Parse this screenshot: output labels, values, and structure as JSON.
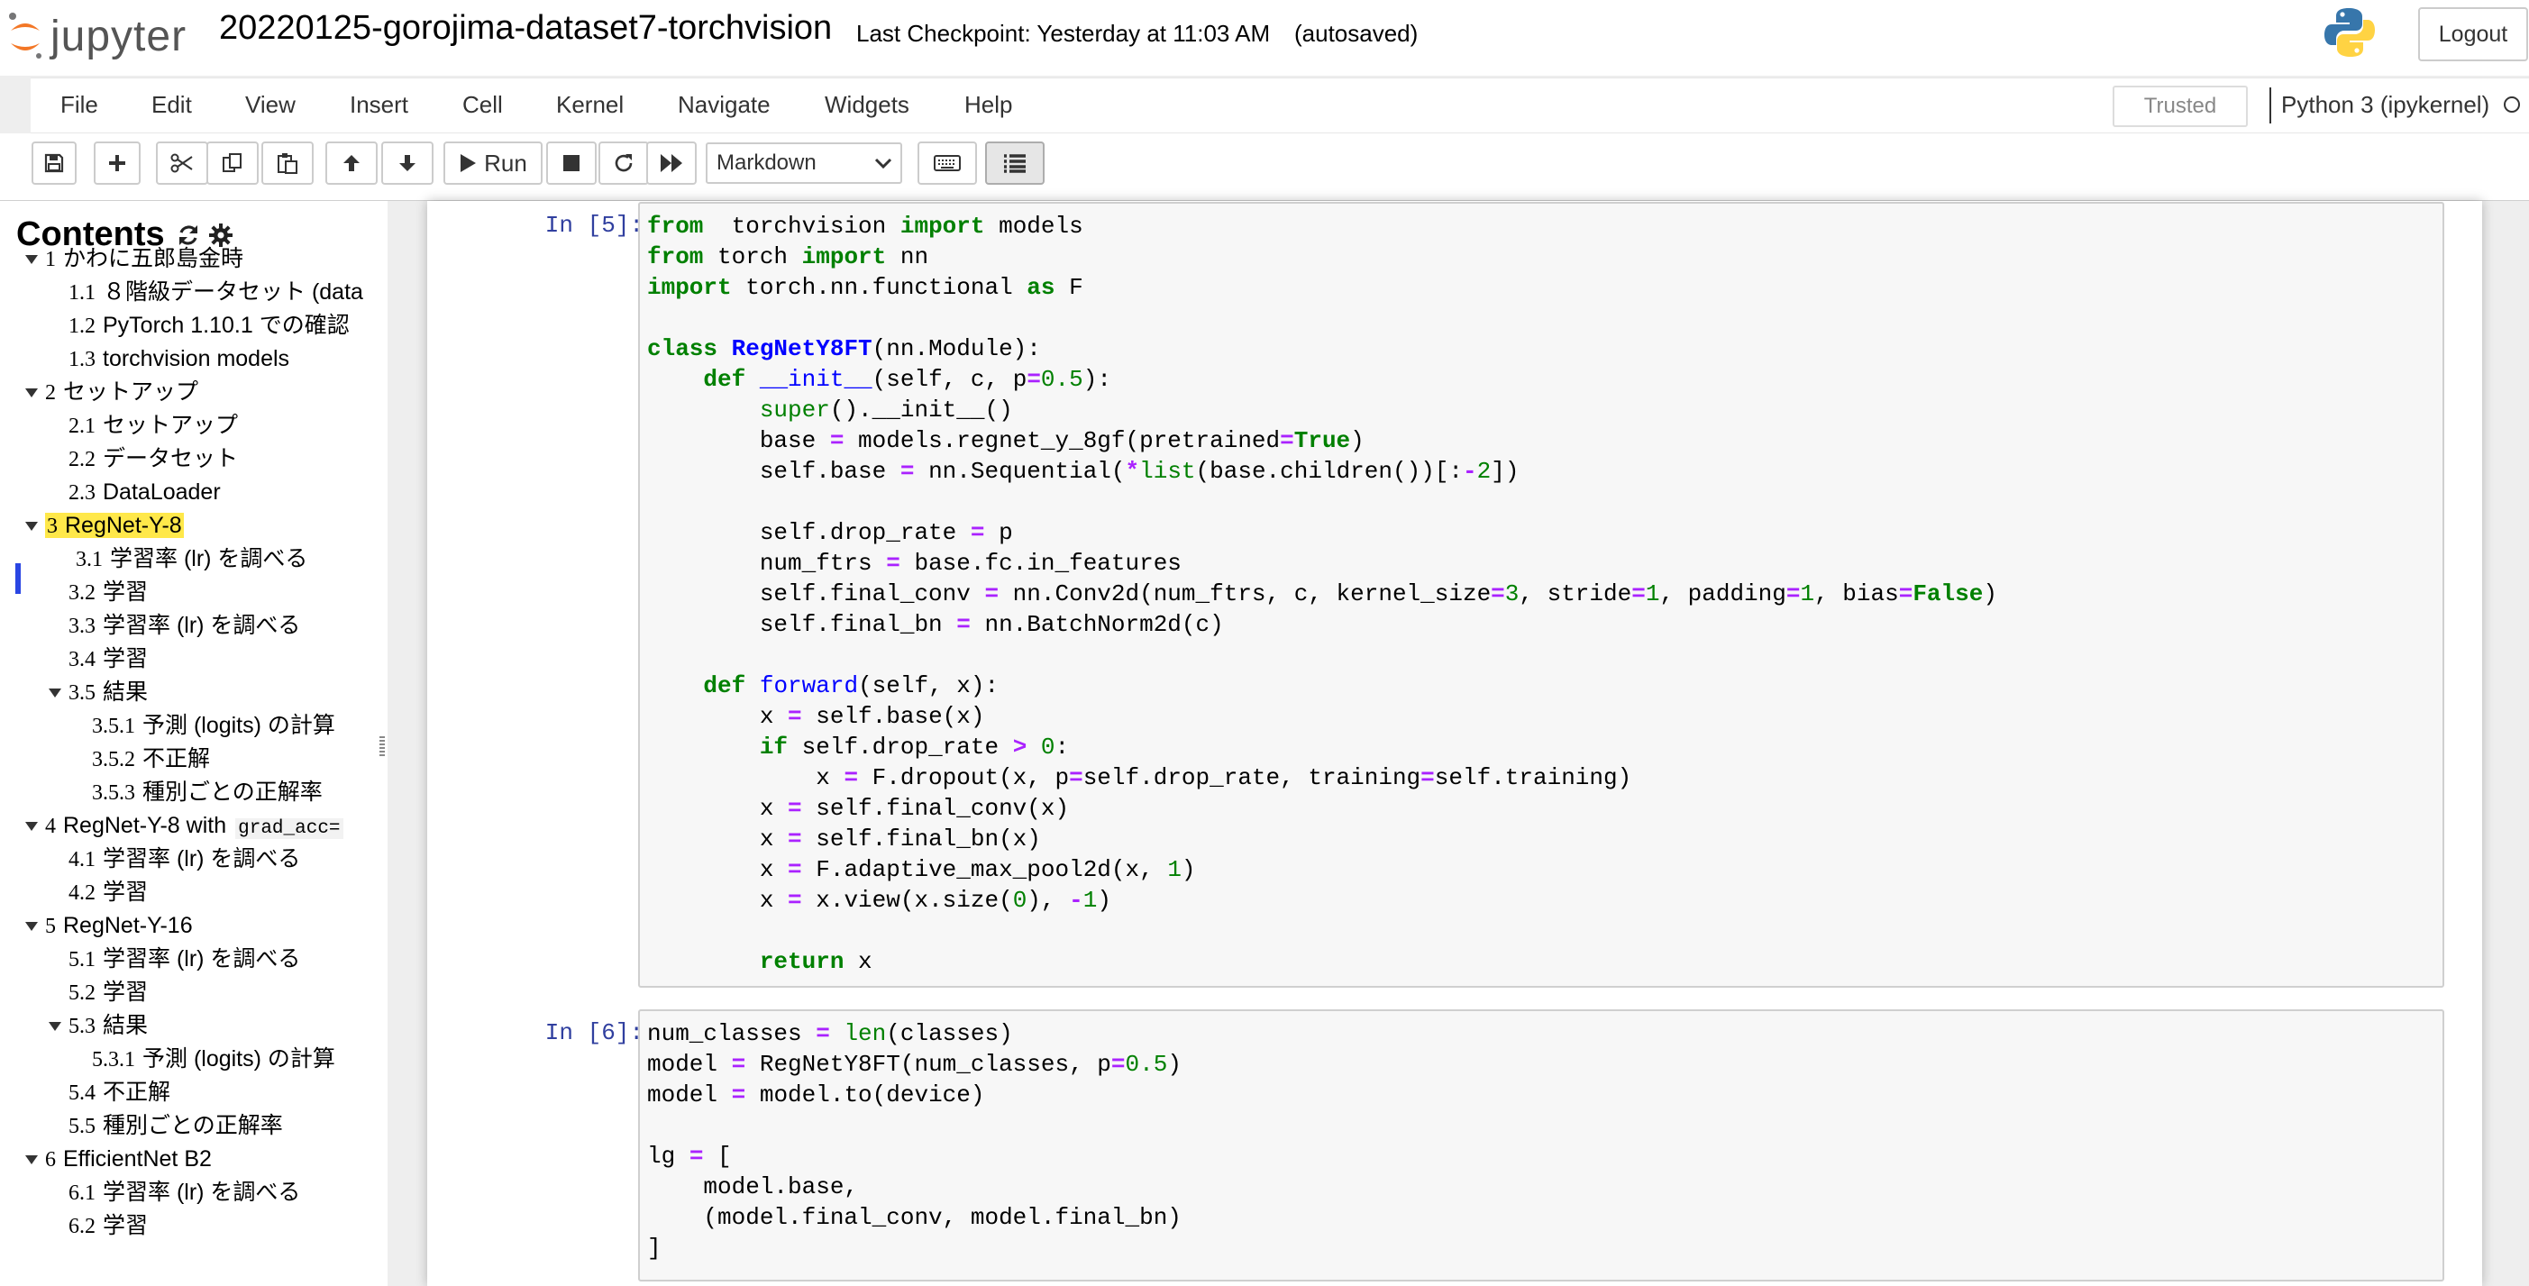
{
  "header": {
    "logo_text": "jupyter",
    "notebook_title": "20220125-gorojima-dataset7-torchvision",
    "checkpoint_text": "Last Checkpoint: Yesterday at 11:03 AM",
    "autosave_status": "(autosaved)",
    "logout_label": "Logout",
    "icons": [
      "jupyter-logo",
      "python-logo"
    ]
  },
  "menubar": {
    "items": [
      "File",
      "Edit",
      "View",
      "Insert",
      "Cell",
      "Kernel",
      "Navigate",
      "Widgets",
      "Help"
    ],
    "trusted_label": "Trusted",
    "kernel_name": "Python 3 (ipykernel)",
    "kernel_status": "idle"
  },
  "toolbar": {
    "run_label": "Run",
    "cell_type": "Markdown",
    "icons": [
      "save-icon",
      "plus-icon",
      "cut-icon",
      "copy-icon",
      "paste-icon",
      "arrow-up-icon",
      "arrow-down-icon",
      "play-icon",
      "stop-icon",
      "restart-icon",
      "fast-forward-icon",
      "keyboard-icon",
      "list-icon"
    ]
  },
  "toc": {
    "title": "Contents",
    "icons": [
      "refresh-icon",
      "gear-icon"
    ],
    "items": [
      {
        "num": "1",
        "label": "かわに五郎島金時",
        "caret": true
      },
      {
        "num": "1.1",
        "label": "８階級データセット (data"
      },
      {
        "num": "1.2",
        "label": "PyTorch 1.10.1 での確認"
      },
      {
        "num": "1.3",
        "label": "torchvision models"
      },
      {
        "num": "2",
        "label": "セットアップ",
        "caret": true
      },
      {
        "num": "2.1",
        "label": "セットアップ"
      },
      {
        "num": "2.2",
        "label": "データセット"
      },
      {
        "num": "2.3",
        "label": "DataLoader"
      },
      {
        "num": "3",
        "label": "RegNet-Y-8",
        "caret": true,
        "highlighted": true
      },
      {
        "num": "3.1",
        "label": "学習率 (lr) を調べる",
        "current": true
      },
      {
        "num": "3.2",
        "label": "学習"
      },
      {
        "num": "3.3",
        "label": "学習率 (lr) を調べる"
      },
      {
        "num": "3.4",
        "label": "学習"
      },
      {
        "num": "3.5",
        "label": "結果",
        "caret": true
      },
      {
        "num": "3.5.1",
        "label": "予測 (logits) の計算"
      },
      {
        "num": "3.5.2",
        "label": "不正解"
      },
      {
        "num": "3.5.3",
        "label": "種別ごとの正解率"
      },
      {
        "num": "4",
        "label": "RegNet-Y-8 with",
        "code": "grad_acc=",
        "caret": true
      },
      {
        "num": "4.1",
        "label": "学習率 (lr) を調べる"
      },
      {
        "num": "4.2",
        "label": "学習"
      },
      {
        "num": "5",
        "label": "RegNet-Y-16",
        "caret": true
      },
      {
        "num": "5.1",
        "label": "学習率 (lr) を調べる"
      },
      {
        "num": "5.2",
        "label": "学習"
      },
      {
        "num": "5.3",
        "label": "結果",
        "caret": true
      },
      {
        "num": "5.3.1",
        "label": "予測 (logits) の計算"
      },
      {
        "num": "5.4",
        "label": "不正解"
      },
      {
        "num": "5.5",
        "label": "種別ごとの正解率"
      },
      {
        "num": "6",
        "label": "EfficientNet B2",
        "caret": true
      },
      {
        "num": "6.1",
        "label": "学習率 (lr) を調べる"
      },
      {
        "num": "6.2",
        "label": "学習"
      }
    ]
  },
  "cells": [
    {
      "prompt": "In [5]:",
      "lines": [
        [
          [
            "kw",
            "from"
          ],
          [
            "",
            "  torchvision "
          ],
          [
            "kw",
            "import"
          ],
          [
            "",
            " models"
          ]
        ],
        [
          [
            "kw",
            "from"
          ],
          [
            "",
            " torch "
          ],
          [
            "kw",
            "import"
          ],
          [
            "",
            " nn"
          ]
        ],
        [
          [
            "kw",
            "import"
          ],
          [
            "",
            " torch.nn.functional "
          ],
          [
            "kw",
            "as"
          ],
          [
            "",
            " F"
          ]
        ],
        [],
        [
          [
            "kw",
            "class"
          ],
          [
            "",
            " "
          ],
          [
            "cls",
            "RegNetY8FT"
          ],
          [
            "",
            "(nn.Module):"
          ]
        ],
        [
          [
            "",
            "    "
          ],
          [
            "kw",
            "def"
          ],
          [
            "",
            " "
          ],
          [
            "fn",
            "__init__"
          ],
          [
            "",
            "(self, c, p"
          ],
          [
            "op",
            "="
          ],
          [
            "num",
            "0.5"
          ],
          [
            "",
            "):"
          ]
        ],
        [
          [
            "",
            "        "
          ],
          [
            "bi",
            "super"
          ],
          [
            "",
            "()."
          ],
          [
            "",
            "__init__"
          ],
          [
            "",
            "()"
          ]
        ],
        [
          [
            "",
            "        base "
          ],
          [
            "op",
            "="
          ],
          [
            "",
            " models.regnet_y_8gf(pretrained"
          ],
          [
            "op",
            "="
          ],
          [
            "kw",
            "True"
          ],
          [
            "",
            ")"
          ]
        ],
        [
          [
            "",
            "        self.base "
          ],
          [
            "op",
            "="
          ],
          [
            "",
            " nn.Sequential("
          ],
          [
            "op",
            "*"
          ],
          [
            "bi",
            "list"
          ],
          [
            "",
            "(base.children())[:"
          ],
          [
            "op",
            "-"
          ],
          [
            "num",
            "2"
          ],
          [
            "",
            "])"
          ]
        ],
        [],
        [
          [
            "",
            "        self.drop_rate "
          ],
          [
            "op",
            "="
          ],
          [
            "",
            " p"
          ]
        ],
        [
          [
            "",
            "        num_ftrs "
          ],
          [
            "op",
            "="
          ],
          [
            "",
            " base.fc.in_features"
          ]
        ],
        [
          [
            "",
            "        self.final_conv "
          ],
          [
            "op",
            "="
          ],
          [
            "",
            " nn.Conv2d(num_ftrs, c, kernel_size"
          ],
          [
            "op",
            "="
          ],
          [
            "num",
            "3"
          ],
          [
            "",
            ", stride"
          ],
          [
            "op",
            "="
          ],
          [
            "num",
            "1"
          ],
          [
            "",
            ", padding"
          ],
          [
            "op",
            "="
          ],
          [
            "num",
            "1"
          ],
          [
            "",
            ", bias"
          ],
          [
            "op",
            "="
          ],
          [
            "kw",
            "False"
          ],
          [
            "",
            ")"
          ]
        ],
        [
          [
            "",
            "        self.final_bn "
          ],
          [
            "op",
            "="
          ],
          [
            "",
            " nn.BatchNorm2d(c)"
          ]
        ],
        [],
        [
          [
            "",
            "    "
          ],
          [
            "kw",
            "def"
          ],
          [
            "",
            " "
          ],
          [
            "fn",
            "forward"
          ],
          [
            "",
            "(self, x):"
          ]
        ],
        [
          [
            "",
            "        x "
          ],
          [
            "op",
            "="
          ],
          [
            "",
            " self.base(x)"
          ]
        ],
        [
          [
            "",
            "        "
          ],
          [
            "kw",
            "if"
          ],
          [
            "",
            " self.drop_rate "
          ],
          [
            "op",
            ">"
          ],
          [
            "",
            " "
          ],
          [
            "num",
            "0"
          ],
          [
            "",
            ":"
          ]
        ],
        [
          [
            "",
            "            x "
          ],
          [
            "op",
            "="
          ],
          [
            "",
            " F.dropout(x, p"
          ],
          [
            "op",
            "="
          ],
          [
            "",
            "self.drop_rate, training"
          ],
          [
            "op",
            "="
          ],
          [
            "",
            "self.training)"
          ]
        ],
        [
          [
            "",
            "        x "
          ],
          [
            "op",
            "="
          ],
          [
            "",
            " self.final_conv(x)"
          ]
        ],
        [
          [
            "",
            "        x "
          ],
          [
            "op",
            "="
          ],
          [
            "",
            " self.final_bn(x)"
          ]
        ],
        [
          [
            "",
            "        x "
          ],
          [
            "op",
            "="
          ],
          [
            "",
            " F.adaptive_max_pool2d(x, "
          ],
          [
            "num",
            "1"
          ],
          [
            "",
            ")"
          ]
        ],
        [
          [
            "",
            "        x "
          ],
          [
            "op",
            "="
          ],
          [
            "",
            " x.view(x.size("
          ],
          [
            "num",
            "0"
          ],
          [
            "",
            "), "
          ],
          [
            "op",
            "-"
          ],
          [
            "num",
            "1"
          ],
          [
            "",
            ")"
          ]
        ],
        [],
        [
          [
            "",
            "        "
          ],
          [
            "kw",
            "return"
          ],
          [
            "",
            " x"
          ]
        ]
      ]
    },
    {
      "prompt": "In [6]:",
      "lines": [
        [
          [
            "",
            "num_classes "
          ],
          [
            "op",
            "="
          ],
          [
            "",
            " "
          ],
          [
            "bi",
            "len"
          ],
          [
            "",
            "(classes)"
          ]
        ],
        [
          [
            "",
            "model "
          ],
          [
            "op",
            "="
          ],
          [
            "",
            " RegNetY8FT(num_classes, p"
          ],
          [
            "op",
            "="
          ],
          [
            "num",
            "0.5"
          ],
          [
            "",
            ")"
          ]
        ],
        [
          [
            "",
            "model "
          ],
          [
            "op",
            "="
          ],
          [
            "",
            " model.to(device)"
          ]
        ],
        [],
        [
          [
            "",
            "lg "
          ],
          [
            "op",
            "="
          ],
          [
            "",
            " ["
          ]
        ],
        [
          [
            "",
            "    model.base,"
          ]
        ],
        [
          [
            "",
            "    (model.final_conv, model.final_bn)"
          ]
        ],
        [
          [
            "",
            "]"
          ]
        ]
      ]
    }
  ]
}
